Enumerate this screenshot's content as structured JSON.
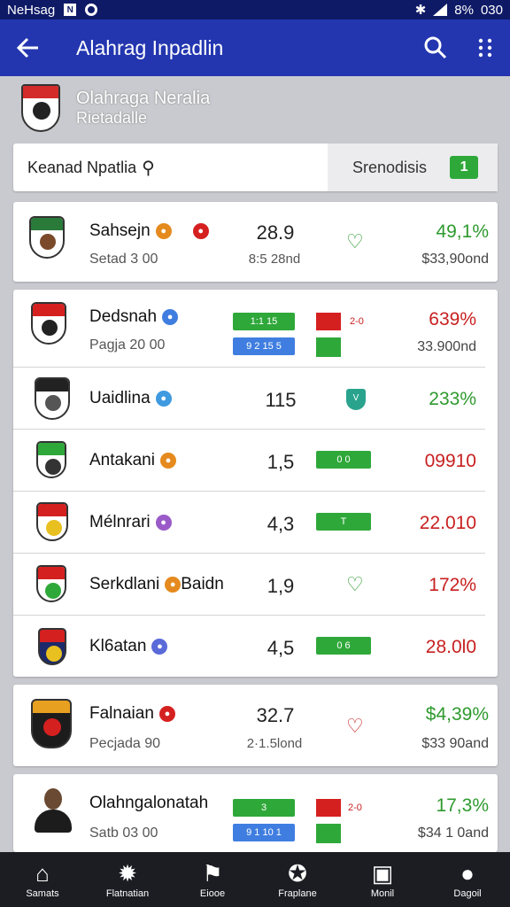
{
  "status_bar": {
    "carrier": "NeHsag",
    "battery": "8%",
    "time": "030"
  },
  "app_bar": {
    "title": "Alahrag Inpadlin"
  },
  "header": {
    "title": "Olahraga Neralia",
    "subtitle": "Rietadalle"
  },
  "search": {
    "value": "Keanad Npatlia",
    "filter_label": "Srenodisis",
    "filter_button": "1"
  },
  "rows": [
    {
      "name": "Sahsejn",
      "sub": "Setad 3 00",
      "score": "28.9",
      "score_sub": "8:5 28nd",
      "pct": "49,1%",
      "pct_sub": "$33,90ond"
    },
    {
      "name": "Dedsnah",
      "sub": "Pagja 20 00",
      "bar1": "1:1 15",
      "bar2": "9 2 15 5",
      "sq_label": "2-0",
      "pct": "639%",
      "pct_sub": "33.900nd"
    },
    {
      "name": "Uaidlina",
      "score": "115",
      "shield": "V",
      "pct": "233%"
    },
    {
      "name": "Antakani",
      "score": "1,5",
      "bar": "0 0",
      "pct": "09910"
    },
    {
      "name": "Mélnrari",
      "score": "4,3",
      "bar": "T",
      "pct": "22.010"
    },
    {
      "name": "Serkdlani",
      "badge_text": "Baidn",
      "score": "1,9",
      "pct": "172%"
    },
    {
      "name": "Kl6atan",
      "score": "4,5",
      "bar": "0 6",
      "pct": "28.0l0"
    },
    {
      "name": "Falnaian",
      "sub": "Pecjada 90",
      "score": "32.7",
      "score_sub": "2·1.5lond",
      "pct": "$4,39%",
      "pct_sub": "$33 90and"
    },
    {
      "name": "Olahngalonatah",
      "sub": "Satb 03 00",
      "bar1": "3",
      "bar2": "9 1 10 1",
      "sq_label": "2-0",
      "pct": "17,3%",
      "pct_sub": "$34 1 0and"
    }
  ],
  "bottom_nav": [
    {
      "label": "Samats",
      "icon": "home-icon"
    },
    {
      "label": "Flatnatian",
      "icon": "ball-icon"
    },
    {
      "label": "Eiooe",
      "icon": "runner-icon"
    },
    {
      "label": "Fraplane",
      "icon": "trophy-icon"
    },
    {
      "label": "Monil",
      "icon": "grid-icon"
    },
    {
      "label": "Dagoil",
      "icon": "profile-icon"
    }
  ],
  "colors": {
    "app_bar": "#2336b0",
    "status_bar": "#0f1a66",
    "positive": "#2e9a2e",
    "negative": "#c82020",
    "nav": "#1c1d23"
  }
}
